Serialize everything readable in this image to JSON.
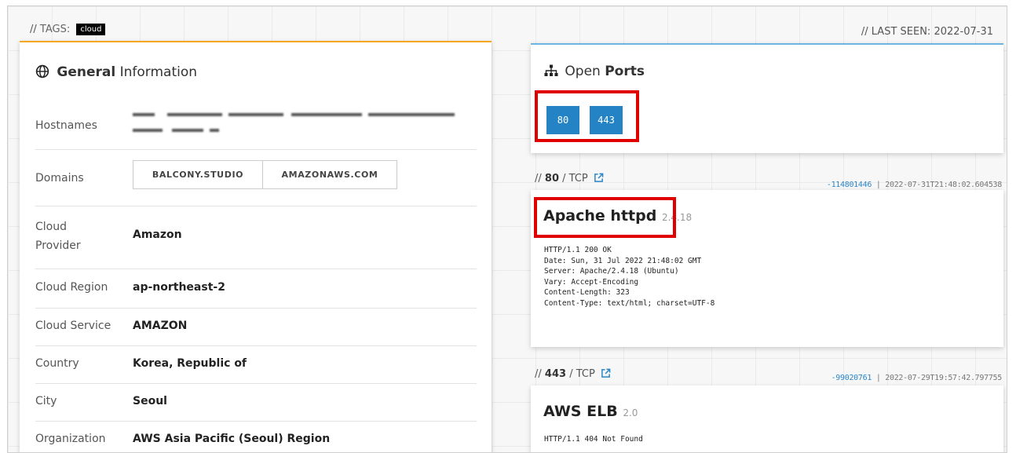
{
  "header": {
    "tags_label": "TAGS:",
    "tag": "cloud",
    "last_seen": "// LAST SEEN: 2022-07-31"
  },
  "general": {
    "title_bold": "General",
    "title_rest": "Information",
    "rows": {
      "hostnames": {
        "label": "Hostnames"
      },
      "domains": {
        "label": "Domains",
        "values": [
          "BALCONY.STUDIO",
          "AMAZONAWS.COM"
        ]
      },
      "cloud_provider": {
        "label": "Cloud Provider",
        "value": "Amazon"
      },
      "cloud_region": {
        "label": "Cloud Region",
        "value": "ap-northeast-2"
      },
      "cloud_service": {
        "label": "Cloud Service",
        "value": "AMAZON"
      },
      "country": {
        "label": "Country",
        "value": "Korea, Republic of"
      },
      "city": {
        "label": "City",
        "value": "Seoul"
      },
      "organization": {
        "label": "Organization",
        "value": "AWS Asia Pacific (Seoul) Region"
      }
    }
  },
  "ports": {
    "title_rest": "Open",
    "title_bold": "Ports",
    "list": [
      "80",
      "443"
    ]
  },
  "services": [
    {
      "port": "80",
      "proto": "/ TCP",
      "hash": "-114801446",
      "timestamp": "| 2022-07-31T21:48:02.604538",
      "product": "Apache httpd",
      "version": "2.4.18",
      "banner": "HTTP/1.1 200 OK\nDate: Sun, 31 Jul 2022 21:48:02 GMT\nServer: Apache/2.4.18 (Ubuntu)\nVary: Accept-Encoding\nContent-Length: 323\nContent-Type: text/html; charset=UTF-8"
    },
    {
      "port": "443",
      "proto": "/ TCP",
      "hash": "-99020761",
      "timestamp": "| 2022-07-29T19:57:42.797755",
      "product": "AWS ELB",
      "version": "2.0",
      "banner": "HTTP/1.1 404 Not Found"
    }
  ],
  "colors": {
    "accent_orange": "#f5a623",
    "accent_blue": "#6fb3e0",
    "port_button": "#2483c5",
    "highlight_red": "#e00000"
  },
  "icons": [
    "globe-icon",
    "network-icon",
    "external-link-icon"
  ]
}
